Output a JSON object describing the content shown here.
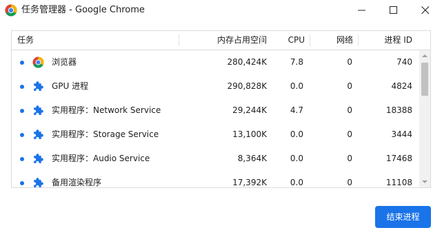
{
  "window": {
    "title": "任务管理器 - Google Chrome",
    "icon": "chrome-icon",
    "controls": [
      "minimize-icon",
      "maximize-icon",
      "close-icon"
    ]
  },
  "table": {
    "columns": {
      "task": "任务",
      "memory": "内存占用空间",
      "cpu": "CPU",
      "network": "网络",
      "pid": "进程 ID"
    },
    "rows": [
      {
        "icon": "chrome-icon",
        "name": "浏览器",
        "memory": "280,424K",
        "cpu": "7.8",
        "network": "0",
        "pid": "740"
      },
      {
        "icon": "puzzle-piece-icon",
        "name": "GPU 进程",
        "memory": "290,828K",
        "cpu": "0.0",
        "network": "0",
        "pid": "4824"
      },
      {
        "icon": "puzzle-piece-icon",
        "name": "实用程序：Network Service",
        "memory": "29,244K",
        "cpu": "4.7",
        "network": "0",
        "pid": "18388"
      },
      {
        "icon": "puzzle-piece-icon",
        "name": "实用程序：Storage Service",
        "memory": "13,100K",
        "cpu": "0.0",
        "network": "0",
        "pid": "3444"
      },
      {
        "icon": "puzzle-piece-icon",
        "name": "实用程序：Audio Service",
        "memory": "8,364K",
        "cpu": "0.0",
        "network": "0",
        "pid": "17468"
      },
      {
        "icon": "puzzle-piece-icon",
        "name": "备用渲染程序",
        "memory": "17,392K",
        "cpu": "0.0",
        "network": "0",
        "pid": "11108"
      }
    ]
  },
  "footer": {
    "end_process_label": "结束进程"
  },
  "colors": {
    "accent": "#1a73e8",
    "border": "#dadce0",
    "text": "#202124"
  }
}
